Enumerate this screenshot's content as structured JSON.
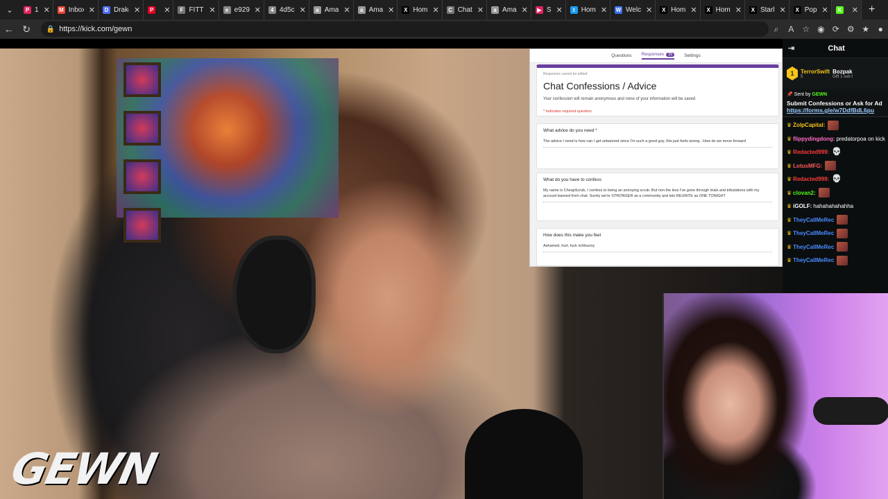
{
  "browser": {
    "tabs": [
      {
        "title": "1",
        "color": "#e0245e",
        "icon": "pinterest-icon",
        "glyph": "P"
      },
      {
        "title": "Inbox",
        "color": "#ea4335",
        "icon": "gmail-icon",
        "glyph": "M"
      },
      {
        "title": "Drake",
        "color": "#4a6cf7",
        "icon": "drive-icon",
        "glyph": "D"
      },
      {
        "title": "",
        "color": "#e60023",
        "icon": "pinterest-icon",
        "glyph": "P"
      },
      {
        "title": "FITTI",
        "color": "#777777",
        "icon": "site-icon",
        "glyph": "F"
      },
      {
        "title": "e929",
        "color": "#888888",
        "icon": "globe-icon",
        "glyph": "e"
      },
      {
        "title": "4d5c",
        "color": "#888888",
        "icon": "globe-icon",
        "glyph": "4"
      },
      {
        "title": "Ama",
        "color": "#999999",
        "icon": "amazon-icon",
        "glyph": "a"
      },
      {
        "title": "Ama",
        "color": "#999999",
        "icon": "amazon-icon",
        "glyph": "a"
      },
      {
        "title": "Hom",
        "color": "#000000",
        "icon": "x-icon",
        "glyph": "X"
      },
      {
        "title": "Chat",
        "color": "#777777",
        "icon": "chat-icon",
        "glyph": "C"
      },
      {
        "title": "Ama",
        "color": "#999999",
        "icon": "amazon-icon",
        "glyph": "a"
      },
      {
        "title": "S",
        "color": "#e0245e",
        "icon": "youtube-icon",
        "glyph": "▶"
      },
      {
        "title": "Hom",
        "color": "#1d9bf0",
        "icon": "twitter-icon",
        "glyph": "t"
      },
      {
        "title": "Welc",
        "color": "#3b6df0",
        "icon": "site-icon",
        "glyph": "W"
      },
      {
        "title": "Hom",
        "color": "#000000",
        "icon": "x-icon",
        "glyph": "X"
      },
      {
        "title": "Hom",
        "color": "#000000",
        "icon": "x-icon",
        "glyph": "X"
      },
      {
        "title": "Starl",
        "color": "#000000",
        "icon": "x-icon",
        "glyph": "X"
      },
      {
        "title": "Pop",
        "color": "#000000",
        "icon": "x-icon",
        "glyph": "X"
      },
      {
        "title": "",
        "color": "#53fc18",
        "icon": "kick-icon",
        "glyph": "K"
      }
    ],
    "url": "https://kick.com/gewn"
  },
  "form": {
    "tabs": [
      "Questions",
      "Responses",
      "Settings"
    ],
    "response_count": "39",
    "notice": "Responses cannot be edited",
    "title": "Chat Confessions / Advice",
    "description": "Your confession will remain anonymous and none of your information will be saved",
    "required_note": "* Indicates required question",
    "questions": [
      {
        "title": "What advice do you need *",
        "answer": "The advice I need is how can I get unbanned since I'm such a good guy, this just feels wrong.. How do we move forward"
      },
      {
        "title": "What do you have to confess",
        "answer": "My name is CheapScrub, I confess to being an annoying scrub. But non the less I've gone through trials and tribulations with my account banned from chat. Surely we're STRONGER as a community and lets REUNITE as ONE TONIGHT"
      },
      {
        "title": "How does this make you feel",
        "answer": "Ashamed, hurt, fuck richbunny"
      }
    ]
  },
  "streamer_logo": "GEWN",
  "chat": {
    "title": "Chat",
    "gift": {
      "rank": "1",
      "user1": "TerrorSwift",
      "count": "5",
      "user2": "Bozpak",
      "sub_text": "Gift 1 sub t"
    },
    "pinned": {
      "sent_by_label": "Sent by",
      "sender": "GEWN",
      "message": "Submit Confessions or Ask for Ad",
      "link": "https://forms.gle/w7DdfBdL6pu"
    },
    "messages": [
      {
        "user": "ZolpCapital:",
        "color": "#f5c518",
        "text": "",
        "emote": "emote"
      },
      {
        "user": "flippydingdong:",
        "color": "#ff6ec7",
        "text": "predatorpoa on kick",
        "emote": ""
      },
      {
        "user": "Redacted999:",
        "color": "#ff3b3b",
        "text": "",
        "emote": "skull"
      },
      {
        "user": "LotusMFG:",
        "color": "#ff5b5b",
        "text": "",
        "emote": "emote"
      },
      {
        "user": "Redacted999:",
        "color": "#ff3b3b",
        "text": "",
        "emote": "skull"
      },
      {
        "user": "clovan2:",
        "color": "#53fc18",
        "text": "",
        "emote": "emote"
      },
      {
        "user": "iGOLF:",
        "color": "#ffffff",
        "text": "hahahahahahha",
        "emote": ""
      },
      {
        "user": "TheyCallMeRec",
        "color": "#4a8cff",
        "text": "",
        "emote": "emote"
      },
      {
        "user": "TheyCallMeRec",
        "color": "#4a8cff",
        "text": "",
        "emote": "emote"
      },
      {
        "user": "TheyCallMeRec",
        "color": "#4a8cff",
        "text": "",
        "emote": "emote"
      },
      {
        "user": "TheyCallMeRec",
        "color": "#4a8cff",
        "text": "",
        "emote": "emote"
      }
    ]
  }
}
